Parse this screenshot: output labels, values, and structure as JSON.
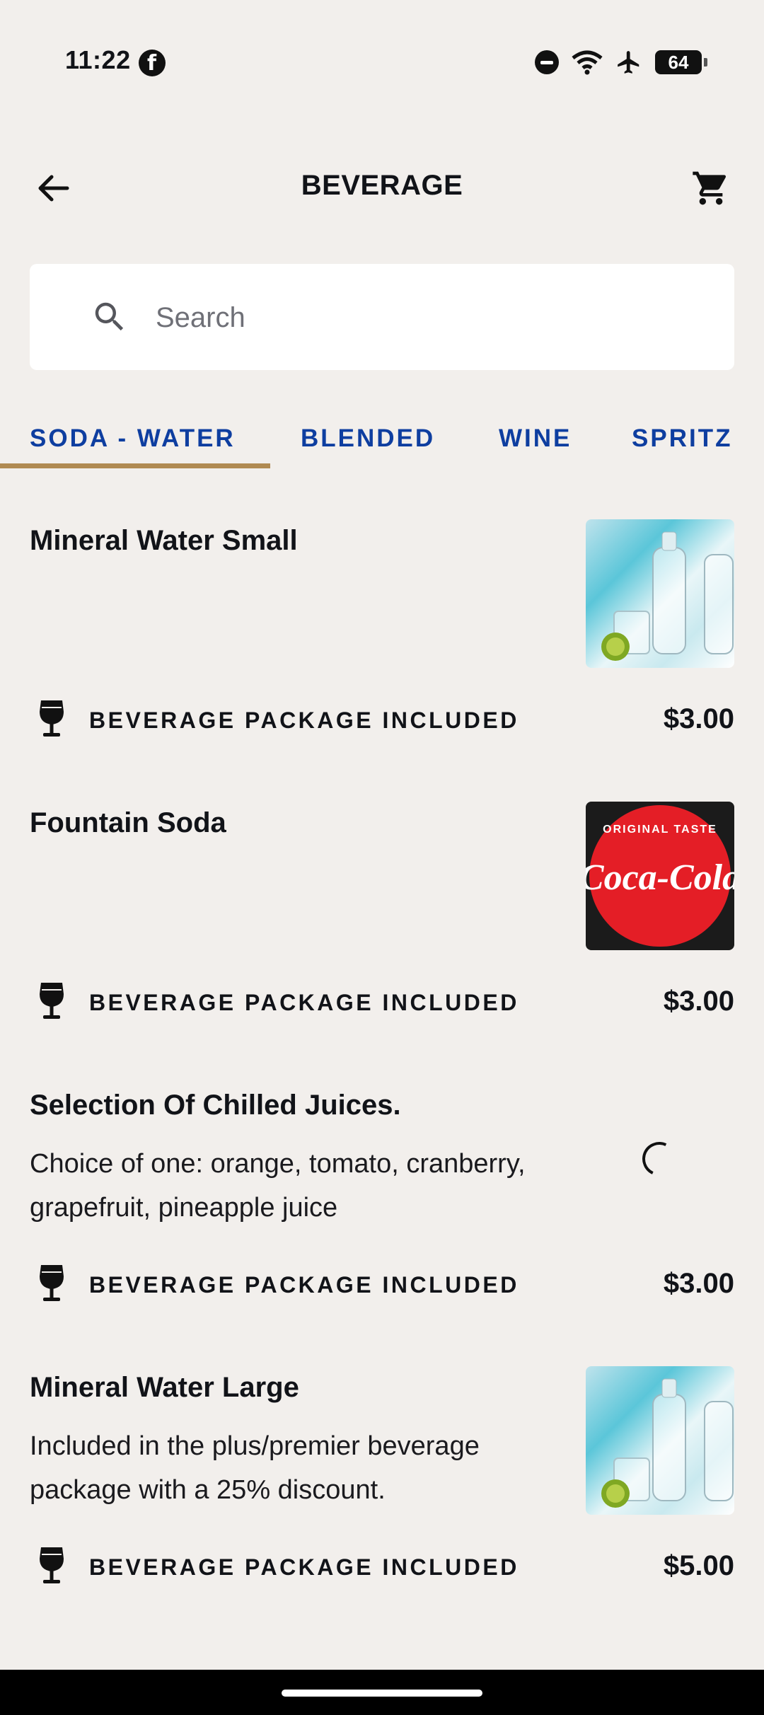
{
  "status_bar": {
    "time": "11:22",
    "battery": "64"
  },
  "header": {
    "title": "BEVERAGE"
  },
  "search": {
    "placeholder": "Search"
  },
  "tabs": [
    {
      "label": "SODA - WATER",
      "active": true
    },
    {
      "label": "BLENDED",
      "active": false
    },
    {
      "label": "WINE",
      "active": false
    },
    {
      "label": "SPRITZ",
      "active": false
    }
  ],
  "items": [
    {
      "name": "Mineral Water Small",
      "description": "",
      "package_label": "BEVERAGE PACKAGE INCLUDED",
      "price": "$3.00",
      "image": "mineral-water"
    },
    {
      "name": "Fountain Soda",
      "description": "",
      "package_label": "BEVERAGE PACKAGE INCLUDED",
      "price": "$3.00",
      "image": "coca-cola-logo",
      "image_text": {
        "top": "ORIGINAL TASTE",
        "brand": "Coca-Cola"
      }
    },
    {
      "name": "Selection Of Chilled Juices.",
      "description": "Choice of one: orange, tomato, cranberry, grapefruit, pineapple juice",
      "package_label": "BEVERAGE PACKAGE INCLUDED",
      "price": "$3.00",
      "image": "loading"
    },
    {
      "name": "Mineral Water Large",
      "description": "Included in the plus/premier beverage package with a 25% discount.",
      "package_label": "BEVERAGE PACKAGE INCLUDED",
      "price": "$5.00",
      "image": "mineral-water"
    }
  ],
  "colors": {
    "accent_tab": "#0e3ea0",
    "tab_underline": "#b08a52",
    "background": "#f2efec"
  }
}
